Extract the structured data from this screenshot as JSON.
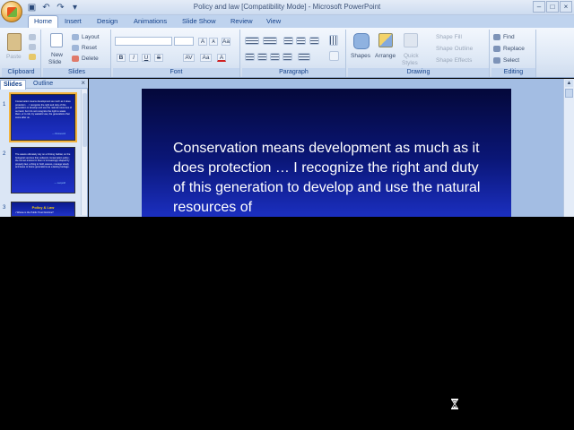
{
  "window": {
    "title": "Policy and law [Compatibility Mode] - Microsoft PowerPoint",
    "controls": [
      "–",
      "□",
      "×"
    ]
  },
  "qat": {
    "save_glyph": "▣",
    "undo_glyph": "↶",
    "redo_glyph": "↷",
    "more_glyph": "▾"
  },
  "tabs": [
    "Home",
    "Insert",
    "Design",
    "Animations",
    "Slide Show",
    "Review",
    "View"
  ],
  "ribbon": {
    "clipboard": {
      "label": "Clipboard",
      "paste": "Paste"
    },
    "slides": {
      "label": "Slides",
      "new_slide": "New",
      "new_slide_2": "Slide",
      "layout": "Layout",
      "reset": "Reset",
      "delete": "Delete"
    },
    "font": {
      "label": "Font",
      "grow": "A",
      "shrink": "A",
      "clear": "Aa",
      "bold": "B",
      "italic": "I",
      "underline": "U",
      "strike": "S",
      "spacing": "AV",
      "case": "Aa",
      "color": "A"
    },
    "paragraph": {
      "label": "Paragraph"
    },
    "drawing": {
      "label": "Drawing",
      "shapes": "Shapes",
      "arrange": "Arrange",
      "quick": "Quick",
      "styles": "Styles",
      "shape_fill": "Shape Fill",
      "shape_outline": "Shape Outline",
      "shape_effects": "Shape Effects"
    },
    "editing": {
      "label": "Editing",
      "find": "Find",
      "replace": "Replace",
      "select": "Select"
    }
  },
  "left_pane": {
    "tab_slides": "Slides",
    "tab_outline": "Outline",
    "close": "×",
    "thumbnails": [
      {
        "num": "1",
        "text": "Conservation means development as much as it does protection … I recognize the right and duty of this generation to develop and use the natural resources of our land, but I do not recognize the right to waste them, or to rob, by wasteful use, the generations that come after us.",
        "link": "— Roosevelt"
      },
      {
        "num": "2",
        "text": "The assets ultimately rely on a thriving habitat, on the biological services that underpin conservation policy; the human interest in them is increasingly shaped by property law, a thing to hold, assess, manage wisely and leave to future generations as a lasting heritage.",
        "link": "— Leopold"
      },
      {
        "num": "3",
        "title": "Policy & Law",
        "sub": "• Whose is the Public Trust Doctrine?"
      }
    ]
  },
  "slide": {
    "text": "Conservation means development as much as it does protection … I recognize the right and duty of this generation to develop and use the natural resources of"
  }
}
